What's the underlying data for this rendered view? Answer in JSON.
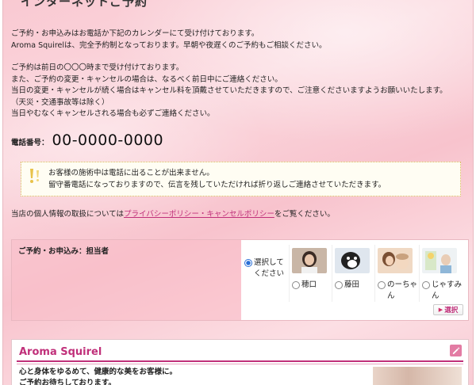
{
  "page": {
    "heading": "インターネットご予約"
  },
  "intro": {
    "line1": "ご予約・お申込みはお電話か下記のカレンダーにて受け付けております。",
    "line2": "Aroma Squirelは、完全予約制となっております。早朝や夜遅くのご予約もご相談ください。"
  },
  "policy": {
    "line1": "ご予約は前日の〇〇〇時まで受け付けております。",
    "line2": "また、ご予約の変更・キャンセルの場合は、なるべく前日中にご連絡ください。",
    "line3": "当日の変更・キャンセルが続く場合はキャンセル料を頂戴させていただきますので、ご注意くださいますようお願いいたします。",
    "line4": "（天災・交通事故等は除く）",
    "line5": "当日やむなくキャンセルされる場合も必ずご連絡ください。"
  },
  "phone": {
    "label": "電話番号：",
    "number": "00-0000-0000"
  },
  "notice": {
    "line1": "お客様の施術中は電話に出ることが出来ません。",
    "line2": "留守番電話になっておりますので、伝言を残していただければ折り返しご連絡させていただきます。",
    "icon": "exclamation-icon"
  },
  "privacy": {
    "prefix": "当店の個人情報の取扱については",
    "link": "プライバシーポリシー・キャンセルポリシー",
    "suffix": "をご覧ください。"
  },
  "form": {
    "label": "ご予約・お申込み：担当者",
    "default_option": "選択してください",
    "staff": [
      {
        "name": "穂口"
      },
      {
        "name": "藤田"
      },
      {
        "name": "のーちゃん"
      },
      {
        "name": "じゃすみん"
      }
    ],
    "select_button": "選択"
  },
  "shop": {
    "title": "Aroma Squirel",
    "line1": "心と身体をゆるめて、健康的な美をお客様に。",
    "line2": "ご予約お待ちしております。"
  },
  "colors": {
    "accent": "#c0307a",
    "background": "#f9c9d2"
  }
}
